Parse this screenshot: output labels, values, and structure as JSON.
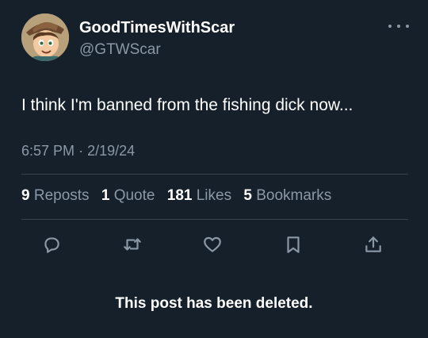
{
  "author": {
    "display_name": "GoodTimesWithScar",
    "handle": "@GTWScar",
    "avatar_icon": "cartoon-avatar-icon"
  },
  "post": {
    "text": "I think I'm banned from the fishing dick now...",
    "time": "6:57 PM",
    "separator": "·",
    "date": "2/19/24"
  },
  "stats": {
    "reposts_count": "9",
    "reposts_label": "Reposts",
    "quotes_count": "1",
    "quotes_label": "Quote",
    "likes_count": "181",
    "likes_label": "Likes",
    "bookmarks_count": "5",
    "bookmarks_label": "Bookmarks"
  },
  "actions": {
    "icons": [
      "reply-icon",
      "repost-icon",
      "like-icon",
      "bookmark-icon",
      "share-icon"
    ]
  },
  "notice": {
    "deleted_text": "This post has been deleted."
  },
  "colors": {
    "background": "#15202b",
    "primary_text": "#ffffff",
    "secondary_text": "#8b98a5",
    "divider": "#38444d"
  }
}
